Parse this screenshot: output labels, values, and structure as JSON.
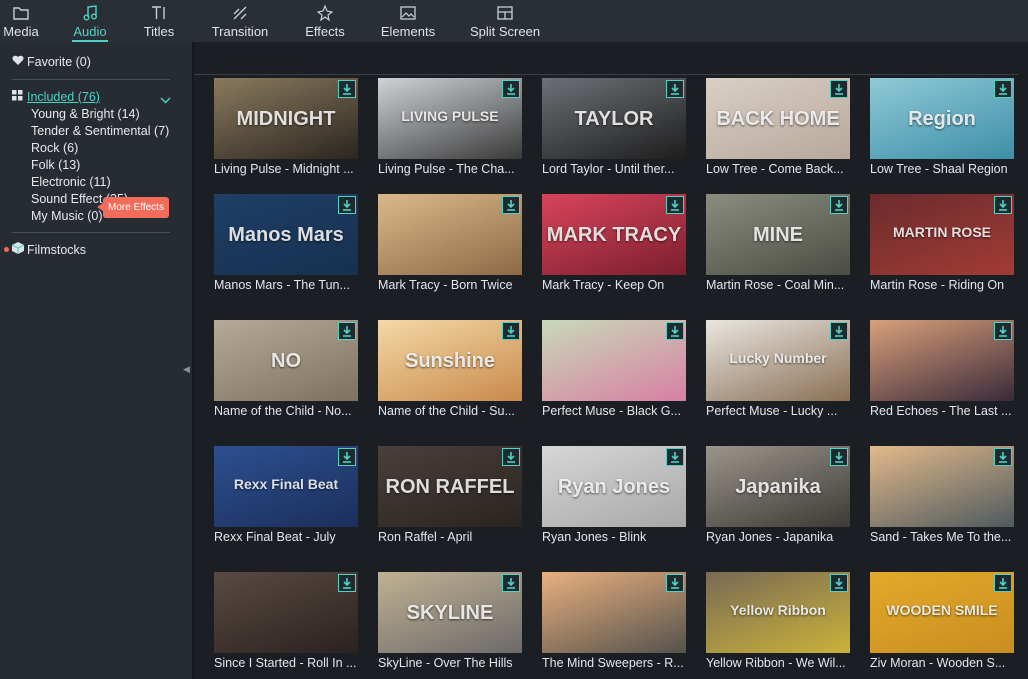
{
  "tabs": [
    {
      "label": "Media",
      "icon": "folder-icon"
    },
    {
      "label": "Audio",
      "icon": "music-note-icon",
      "active": true
    },
    {
      "label": "Titles",
      "icon": "title-text-icon"
    },
    {
      "label": "Transition",
      "icon": "transition-icon"
    },
    {
      "label": "Effects",
      "icon": "effects-sparkle-icon"
    },
    {
      "label": "Elements",
      "icon": "image-icon"
    },
    {
      "label": "Split Screen",
      "icon": "split-screen-icon"
    }
  ],
  "sidebar": {
    "favorite": "Favorite (0)",
    "included": "Included (76)",
    "categories": [
      "Young & Bright (14)",
      "Tender & Sentimental (7)",
      "Rock (6)",
      "Folk (13)",
      "Electronic (11)",
      "Sound Effect (25)",
      "My Music (0)"
    ],
    "filmstocks": "Filmstocks",
    "more_effects": "More Effects"
  },
  "colors": {
    "accent": "#4fd1c5",
    "badge": "#f26b5b",
    "background": "#1b1f24"
  },
  "tracks": [
    {
      "caption": "Living Pulse - Midnight ...",
      "thumb_text": "MIDNIGHT",
      "colors": [
        "#8a7a5e",
        "#2b2620"
      ]
    },
    {
      "caption": "Living Pulse - The Cha...",
      "thumb_text": "LIVING PULSE",
      "colors": [
        "#cfd2d6",
        "#3a3a3a"
      ]
    },
    {
      "caption": "Lord Taylor - Until ther...",
      "thumb_text": "TAYLOR",
      "colors": [
        "#6c7075",
        "#1e1e1e"
      ]
    },
    {
      "caption": "Low Tree - Come Back...",
      "thumb_text": "BACK HOME",
      "colors": [
        "#d9cfc6",
        "#b7a89a"
      ]
    },
    {
      "caption": "Low Tree - Shaal Region",
      "thumb_text": "Region",
      "colors": [
        "#8fc9d6",
        "#3d8fa8"
      ]
    },
    {
      "caption": "Manos Mars - The Tun...",
      "thumb_text": "Manos Mars",
      "colors": [
        "#1f3f66",
        "#16304f"
      ]
    },
    {
      "caption": "Mark Tracy - Born Twice",
      "thumb_text": "",
      "colors": [
        "#d9b98a",
        "#8d6a45"
      ]
    },
    {
      "caption": "Mark Tracy - Keep On",
      "thumb_text": "MARK TRACY",
      "colors": [
        "#d9445a",
        "#7a1f2f"
      ]
    },
    {
      "caption": "Martin Rose - Coal Min...",
      "thumb_text": "MINE",
      "colors": [
        "#8a8d80",
        "#4b4d44"
      ]
    },
    {
      "caption": "Martin Rose - Riding On",
      "thumb_text": "MARTIN ROSE",
      "colors": [
        "#6b2c2c",
        "#a23b36"
      ]
    },
    {
      "caption": "Name of the Child - No...",
      "thumb_text": "NO",
      "colors": [
        "#b5aa96",
        "#7d7261"
      ]
    },
    {
      "caption": "Name of the Child - Su...",
      "thumb_text": "Sunshine",
      "colors": [
        "#f3d8a6",
        "#c98a4b"
      ]
    },
    {
      "caption": "Perfect Muse - Black G...",
      "thumb_text": "",
      "colors": [
        "#c8d9b8",
        "#d77fa3"
      ]
    },
    {
      "caption": "Perfect Muse - Lucky ...",
      "thumb_text": "Lucky Number",
      "colors": [
        "#e9e6e0",
        "#8a6f55"
      ]
    },
    {
      "caption": "Red Echoes - The Last ...",
      "thumb_text": "",
      "colors": [
        "#d9a07a",
        "#3a2a3a"
      ]
    },
    {
      "caption": "Rexx Final Beat - July",
      "thumb_text": "Rexx Final Beat",
      "colors": [
        "#2d4f8f",
        "#1b2f5c"
      ]
    },
    {
      "caption": "Ron Raffel - April",
      "thumb_text": "RON RAFFEL",
      "colors": [
        "#4a3f3a",
        "#2a2420"
      ]
    },
    {
      "caption": "Ryan Jones - Blink",
      "thumb_text": "Ryan Jones",
      "colors": [
        "#d6d6d6",
        "#a8a8a8"
      ]
    },
    {
      "caption": "Ryan Jones - Japanika",
      "thumb_text": "Japanika",
      "colors": [
        "#9a958c",
        "#3d3a35"
      ]
    },
    {
      "caption": "Sand - Takes Me To the...",
      "thumb_text": "",
      "colors": [
        "#e2b98a",
        "#4e5a5e"
      ]
    },
    {
      "caption": "Since I Started - Roll In ...",
      "thumb_text": "",
      "colors": [
        "#5a4a42",
        "#2a2220"
      ]
    },
    {
      "caption": "SkyLine - Over The Hills",
      "thumb_text": "SKYLINE",
      "colors": [
        "#bfb192",
        "#6d6a6a"
      ]
    },
    {
      "caption": "The Mind Sweepers - R...",
      "thumb_text": "",
      "colors": [
        "#e8b07d",
        "#55524d"
      ]
    },
    {
      "caption": "Yellow Ribbon - We Wil...",
      "thumb_text": "Yellow Ribbon",
      "colors": [
        "#7a6a55",
        "#c9b23a"
      ]
    },
    {
      "caption": "Ziv Moran - Wooden S...",
      "thumb_text": "WOODEN SMILE",
      "colors": [
        "#e2a92a",
        "#c98e1f"
      ]
    }
  ]
}
